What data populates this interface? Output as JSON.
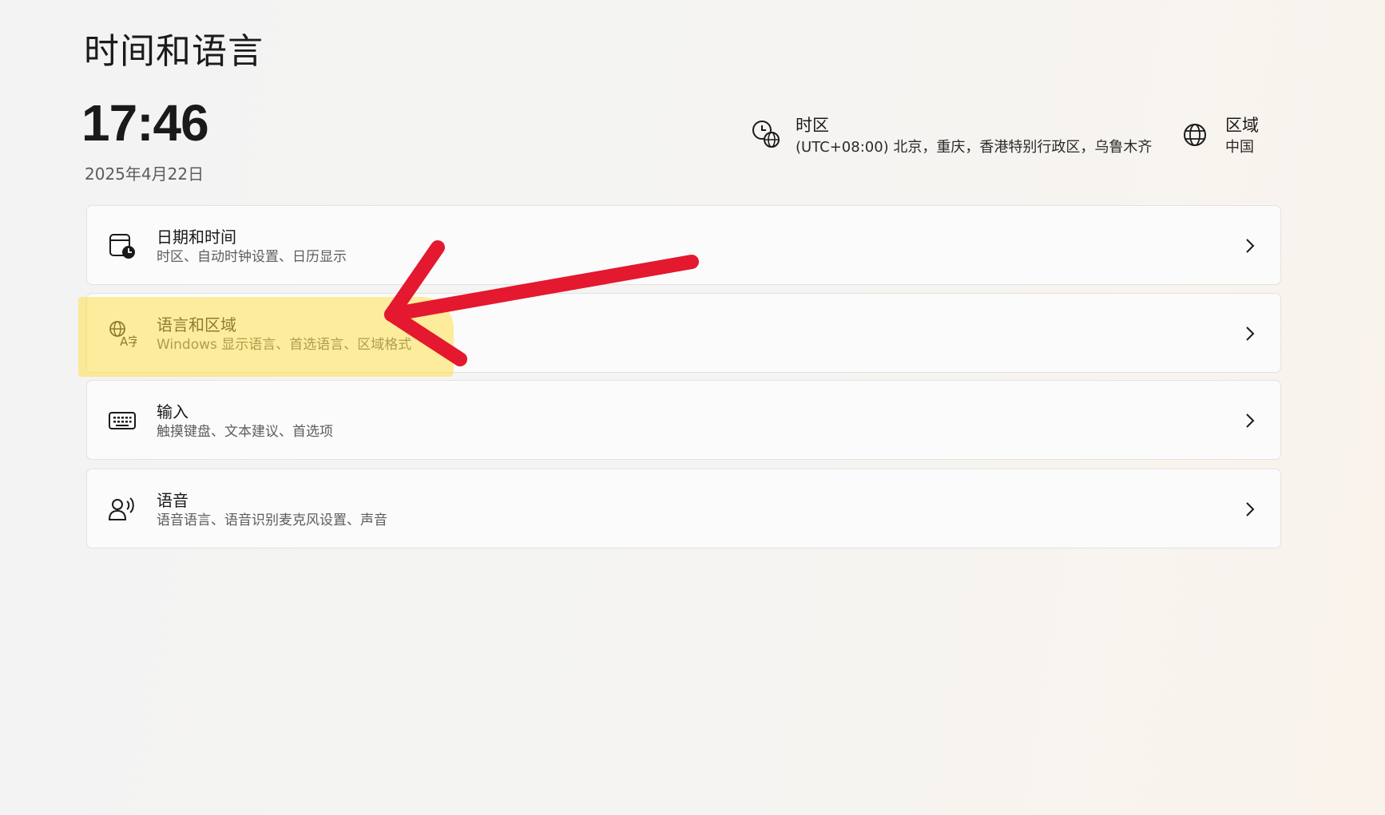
{
  "page": {
    "title": "时间和语言"
  },
  "clock": {
    "time": "17:46",
    "date": "2025年4月22日"
  },
  "timezone": {
    "label": "时区",
    "value": "(UTC+08:00) 北京，重庆，香港特别行政区，乌鲁木齐",
    "icon": "clock-globe-icon"
  },
  "region": {
    "label": "区域",
    "value": "中国",
    "icon": "globe-icon"
  },
  "cards": [
    {
      "title": "日期和时间",
      "subtitle": "时区、自动时钟设置、日历显示",
      "icon": "calendar-clock-icon"
    },
    {
      "title": "语言和区域",
      "subtitle": "Windows 显示语言、首选语言、区域格式",
      "icon": "language-icon"
    },
    {
      "title": "输入",
      "subtitle": "触摸键盘、文本建议、首选项",
      "icon": "keyboard-icon"
    },
    {
      "title": "语音",
      "subtitle": "语音语言、语音识别麦克风设置、声音",
      "icon": "speech-icon"
    }
  ],
  "annotation": {
    "highlight_color": "#ffe04a",
    "arrow_color": "#e4182e"
  }
}
